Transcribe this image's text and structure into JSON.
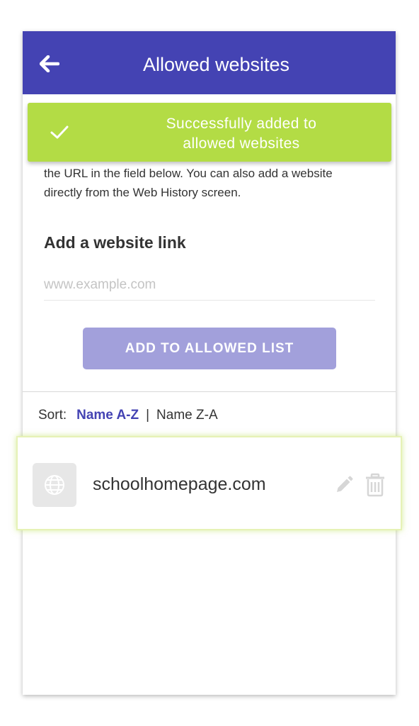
{
  "header": {
    "title": "Allowed websites",
    "back_icon": "arrow-left-icon"
  },
  "toast": {
    "message": "Successfully added to allowed websites",
    "icon": "check-icon",
    "color": "#b3dc45"
  },
  "intro": {
    "text": "the URL in the field below. You can also add a website directly from the Web History screen."
  },
  "add_website": {
    "label": "Add a website link",
    "placeholder": "www.example.com",
    "value": "",
    "button_label": "ADD TO ALLOWED LIST"
  },
  "sort": {
    "label": "Sort:",
    "options": [
      "Name A-Z",
      "Name Z-A"
    ],
    "active": "Name A-Z"
  },
  "sites": [
    {
      "name": "schoolhomepage.com",
      "icon": "globe-icon"
    }
  ],
  "colors": {
    "primary": "#4443b3",
    "success": "#b3dc45",
    "button_disabled": "#a2a0db"
  }
}
